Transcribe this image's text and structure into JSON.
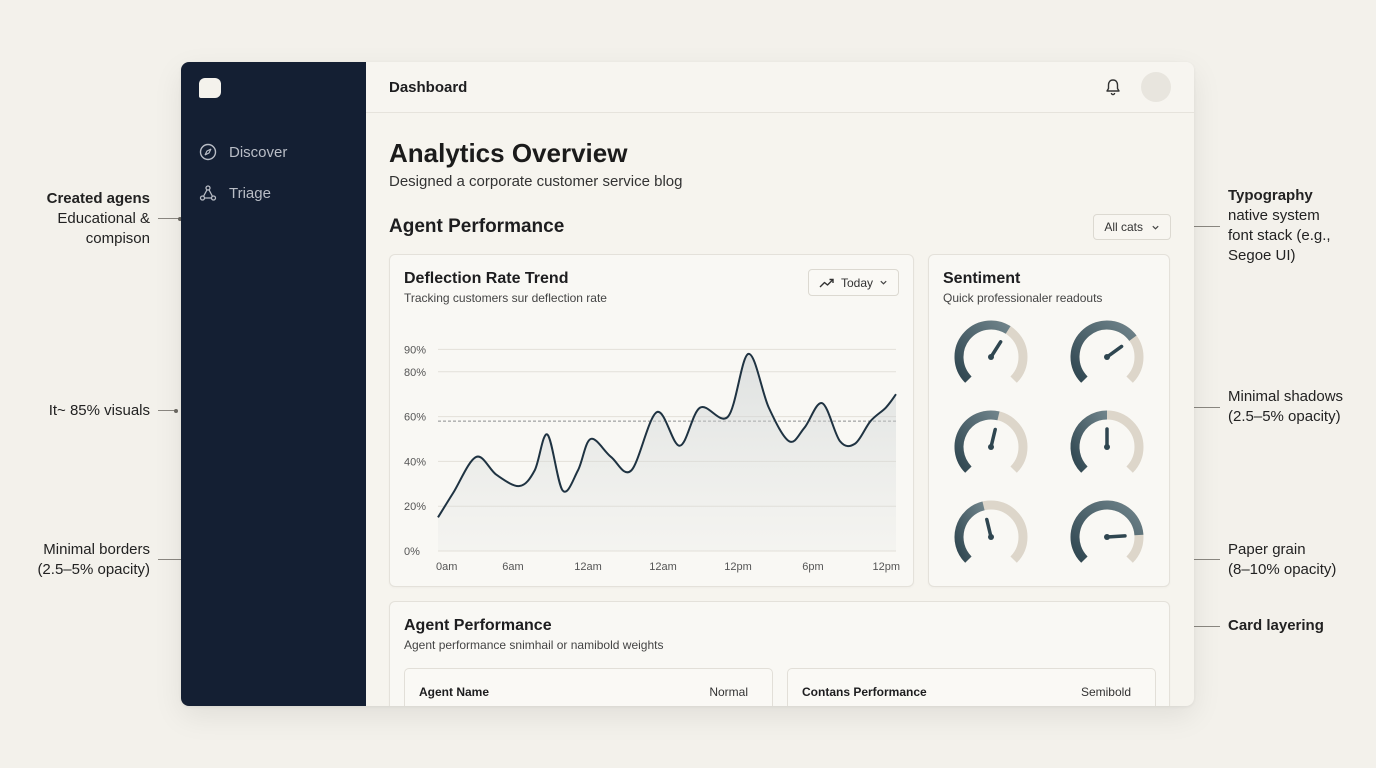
{
  "app": {
    "header_title": "Dashboard",
    "sidebar": {
      "items": [
        {
          "label": "Discover",
          "icon": "compass-icon"
        },
        {
          "label": "Triage",
          "icon": "nodes-icon"
        }
      ]
    },
    "page_title": "Analytics Overview",
    "page_subtitle": "Designed a corporate customer service blog",
    "section_title": "Agent Performance",
    "filter_select": "All cats",
    "chart_card": {
      "title": "Deflection Rate Trend",
      "subtitle": "Tracking customers sur deflection rate",
      "range_button": "Today"
    },
    "sentiment_card": {
      "title": "Sentiment",
      "subtitle": "Quick professionaler readouts",
      "gauges": [
        0.62,
        0.7,
        0.55,
        0.5,
        0.45,
        0.82
      ]
    },
    "performance_card": {
      "title": "Agent Performance",
      "subtitle": "Agent performance snimhail or namibold weights",
      "columns": [
        {
          "label": "Agent Name",
          "value": "Normal"
        },
        {
          "label": "Contans Performance",
          "value": "Semibold"
        }
      ]
    }
  },
  "annotations": {
    "created": {
      "title": "Created agens",
      "lines": [
        "Educational &",
        "compison"
      ]
    },
    "visuals": "It~ 85% visuals",
    "borders": [
      "Minimal borders",
      "(2.5–5% opacity)"
    ],
    "typography": {
      "title": "Typography",
      "lines": [
        "native system",
        "font stack (e.g.,",
        "Segoe UI)"
      ]
    },
    "shadows": [
      "Minimal shadows",
      "(2.5–5% opacity)"
    ],
    "grain": [
      "Paper grain",
      "(8–10% opacity)"
    ],
    "layering": "Card layering"
  },
  "colors": {
    "sidebar": "#141f33",
    "background": "#f3f1eb",
    "line": "#1f3342",
    "gauge_dark": "#2f4650",
    "gauge_track": "#ddd6ca"
  },
  "chart_data": {
    "type": "area",
    "title": "Deflection Rate Trend",
    "x_tick_labels": [
      "0am",
      "6am",
      "12am",
      "12am",
      "12pm",
      "6pm",
      "12pm"
    ],
    "y_tick_labels": [
      "0%",
      "20%",
      "40%",
      "60%",
      "80%",
      "90%"
    ],
    "ylim": [
      0,
      100
    ],
    "reference_line": 58,
    "series": [
      {
        "x": [
          0,
          0.6,
          1.5,
          2.3,
          3.2,
          3.8,
          4.3,
          4.9,
          5.5,
          6.0,
          6.8,
          7.6,
          8.6,
          9.5,
          10.3,
          11.4,
          12.2,
          13.0,
          13.8,
          14.4,
          15.1,
          15.8,
          16.4,
          17.0,
          17.6,
          18.0
        ],
        "y": [
          15,
          26,
          42,
          34,
          29,
          36,
          52,
          27,
          36,
          50,
          42,
          36,
          62,
          47,
          64,
          60,
          88,
          64,
          49,
          55,
          66,
          49,
          48,
          58,
          64,
          70
        ]
      }
    ],
    "grid": true
  }
}
